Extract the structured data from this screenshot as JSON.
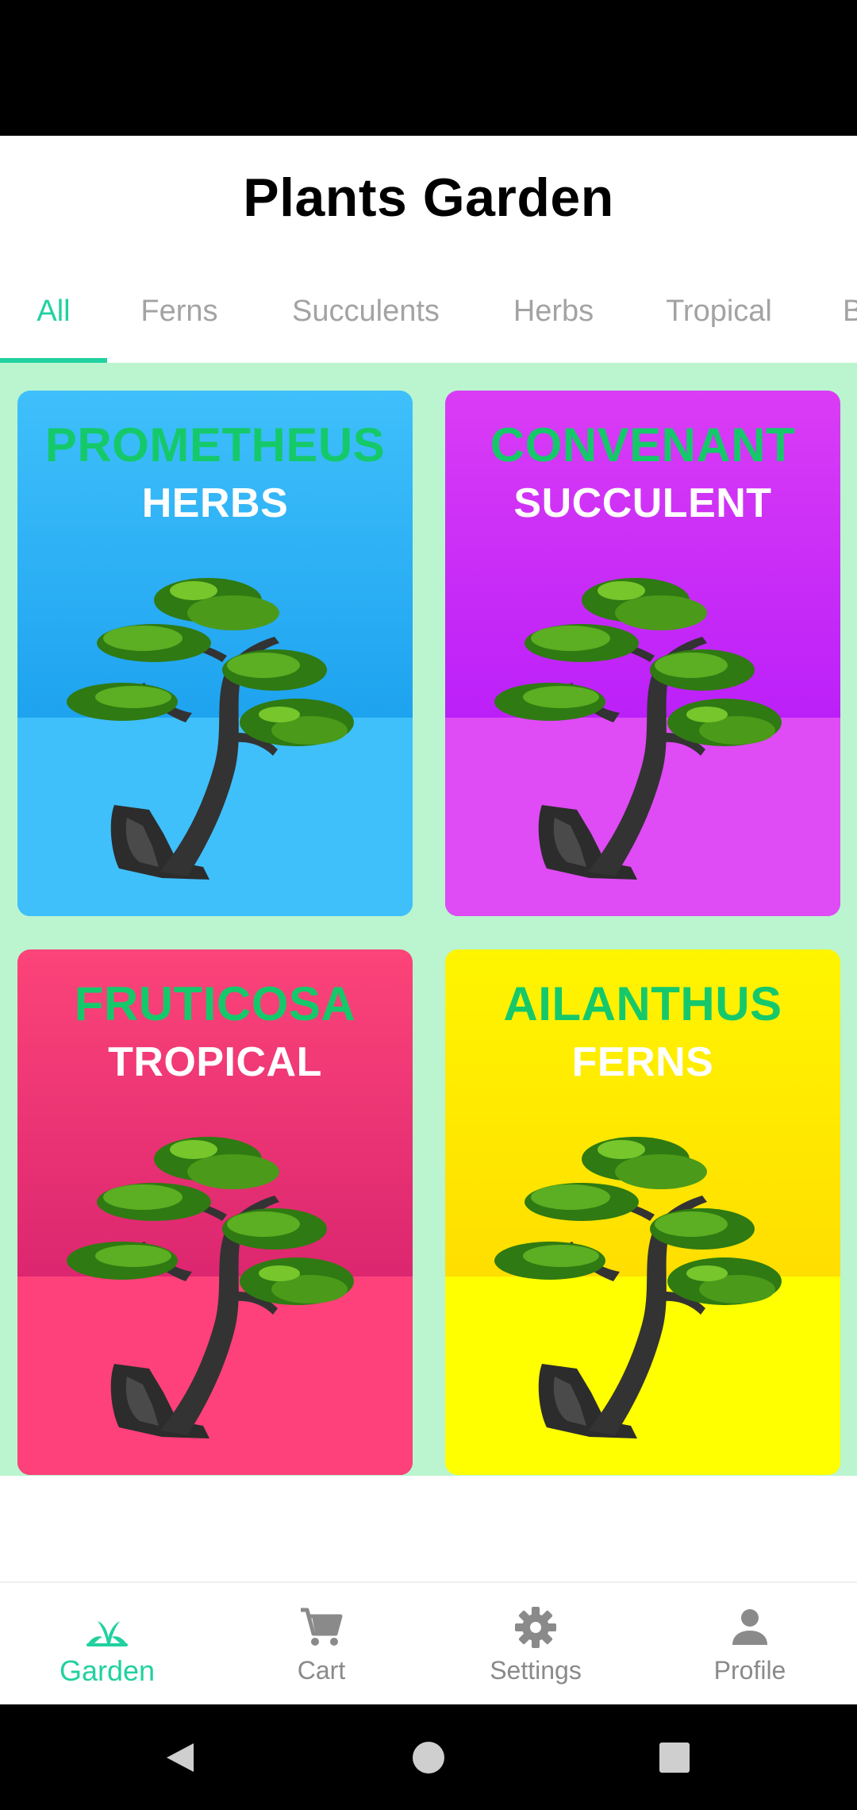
{
  "app": {
    "title": "Plants Garden"
  },
  "tabs": [
    {
      "label": "All",
      "active": true
    },
    {
      "label": "Ferns",
      "active": false
    },
    {
      "label": "Succulents",
      "active": false
    },
    {
      "label": "Herbs",
      "active": false
    },
    {
      "label": "Tropical",
      "active": false
    },
    {
      "label": "B",
      "active": false
    }
  ],
  "plants": [
    {
      "name": "PROMETHEUS",
      "category": "HERBS",
      "colors": {
        "top": "#3fc0fb",
        "mid": "#0a91e8",
        "bottom": "#3fc0fb"
      }
    },
    {
      "name": "CONVENANT",
      "category": "SUCCULENT",
      "colors": {
        "top": "#da3cf5",
        "mid": "#a90ffa",
        "bottom": "#df4bf5"
      }
    },
    {
      "name": "FRUTICOSA",
      "category": "TROPICAL",
      "colors": {
        "top": "#fc4479",
        "mid": "#c8146a",
        "bottom": "#fe417a"
      }
    },
    {
      "name": "AILANTHUS",
      "category": "FERNS",
      "colors": {
        "top": "#fff500",
        "mid": "#ffd000",
        "bottom": "#ffff00"
      }
    }
  ],
  "bottom_nav": [
    {
      "label": "Garden",
      "icon": "grass-icon",
      "active": true
    },
    {
      "label": "Cart",
      "icon": "cart-icon",
      "active": false
    },
    {
      "label": "Settings",
      "icon": "gear-icon",
      "active": false
    },
    {
      "label": "Profile",
      "icon": "person-icon",
      "active": false
    }
  ],
  "theme": {
    "accent": "#21d19f",
    "grid_background": "#bbf5cf",
    "card_title": "#15c96a"
  }
}
